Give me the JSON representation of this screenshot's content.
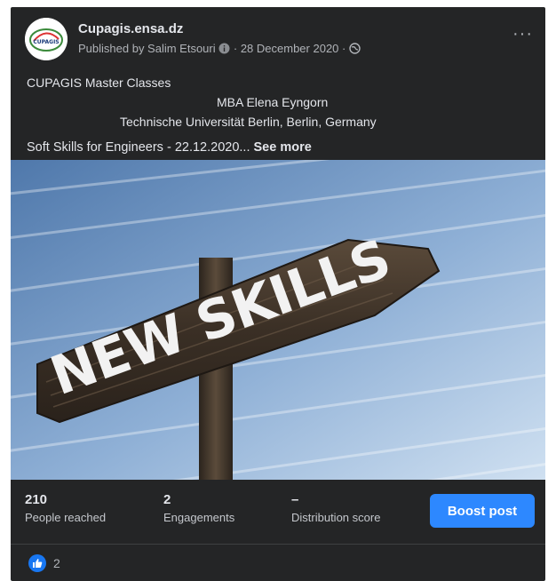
{
  "post": {
    "page_name": "Cupagis.ensa.dz",
    "avatar_text": "CUPAGIS",
    "byline_prefix": "Published by Salim Etsouri",
    "byline_date": "· 28 December 2020 ·",
    "more_label": "···",
    "lines": [
      "CUPAGIS Master Classes",
      "MBA Elena Eyngorn",
      "Technische Universität Berlin, Berlin, Germany",
      "Soft Skills for Engineers - 22.12.2020..."
    ],
    "see_more": "See more",
    "image_text": "NEW SKILLS"
  },
  "insights": {
    "reached": {
      "value": "210",
      "label": "People reached"
    },
    "engagements": {
      "value": "2",
      "label": "Engagements"
    },
    "distribution": {
      "value": "–",
      "label": "Distribution score"
    },
    "boost_label": "Boost post"
  },
  "reactions": {
    "count": "2"
  },
  "colors": {
    "card_bg": "#242526",
    "accent": "#2d88ff",
    "like": "#1877f2"
  },
  "icons": [
    "info-icon",
    "globe-icon",
    "more-options-icon",
    "like-icon"
  ]
}
